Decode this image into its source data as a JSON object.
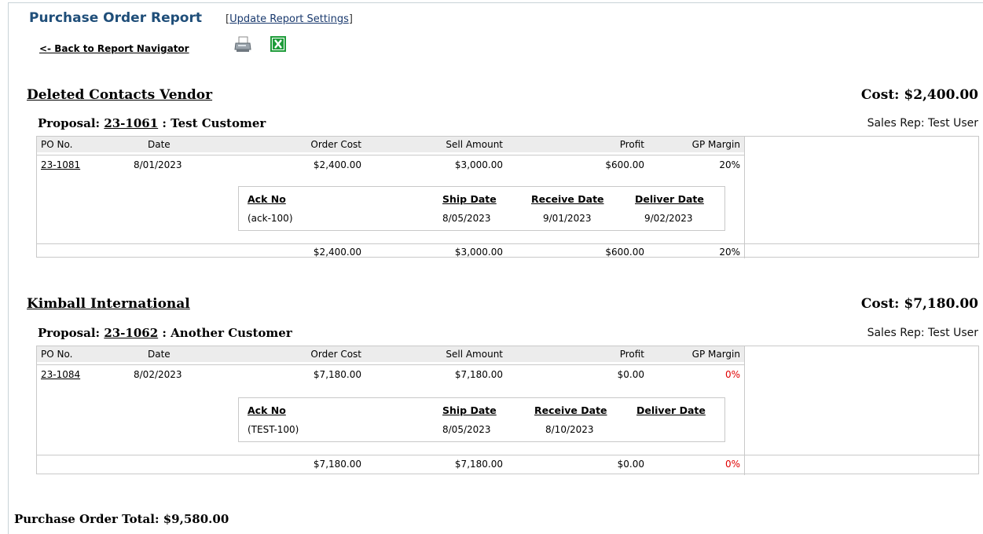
{
  "header": {
    "title": "Purchase Order Report",
    "update_bracket_open": "[",
    "update_label": "Update Report Settings",
    "update_bracket_close": "]",
    "back_label": "<- Back to Report Navigator",
    "print_icon": "print-icon",
    "excel_icon": "excel-icon",
    "excel_color": "#1e9c3a"
  },
  "columns": [
    "PO No.",
    "Date",
    "Order Cost",
    "Sell Amount",
    "Profit",
    "GP Margin"
  ],
  "ack_columns": [
    "Ack No",
    "Ship Date",
    "Receive Date",
    "Deliver Date"
  ],
  "vendors": [
    {
      "name": "Deleted Contacts Vendor",
      "cost": "Cost: $2,400.00",
      "proposal_prefix": "Proposal: ",
      "proposal_no": "23-1061",
      "proposal_suffix": " : Test Customer",
      "sales_rep": "Sales Rep: Test User",
      "po": {
        "po_no": "23-1081",
        "date": "8/01/2023",
        "order_cost": "$2,400.00",
        "sell_amount": "$3,000.00",
        "profit": "$600.00",
        "gp_margin": "20%"
      },
      "ack": {
        "ack_no": "(ack-100)",
        "ship_date": "8/05/2023",
        "receive_date": "9/01/2023",
        "deliver_date": "9/02/2023"
      },
      "totals": {
        "order_cost": "$2,400.00",
        "sell_amount": "$3,000.00",
        "profit": "$600.00",
        "gp_margin": "20%"
      }
    },
    {
      "name": "Kimball International",
      "cost": "Cost: $7,180.00",
      "proposal_prefix": "Proposal: ",
      "proposal_no": "23-1062",
      "proposal_suffix": " : Another Customer",
      "sales_rep": "Sales Rep: Test User",
      "po": {
        "po_no": "23-1084",
        "date": "8/02/2023",
        "order_cost": "$7,180.00",
        "sell_amount": "$7,180.00",
        "profit": "$0.00",
        "gp_margin": "0%"
      },
      "ack": {
        "ack_no": "(TEST-100)",
        "ship_date": "8/05/2023",
        "receive_date": "8/10/2023",
        "deliver_date": ""
      },
      "totals": {
        "order_cost": "$7,180.00",
        "sell_amount": "$7,180.00",
        "profit": "$0.00",
        "gp_margin": "0%"
      }
    }
  ],
  "footer": {
    "total_label": "Purchase Order Total:",
    "total_value": "$9,580.00"
  }
}
